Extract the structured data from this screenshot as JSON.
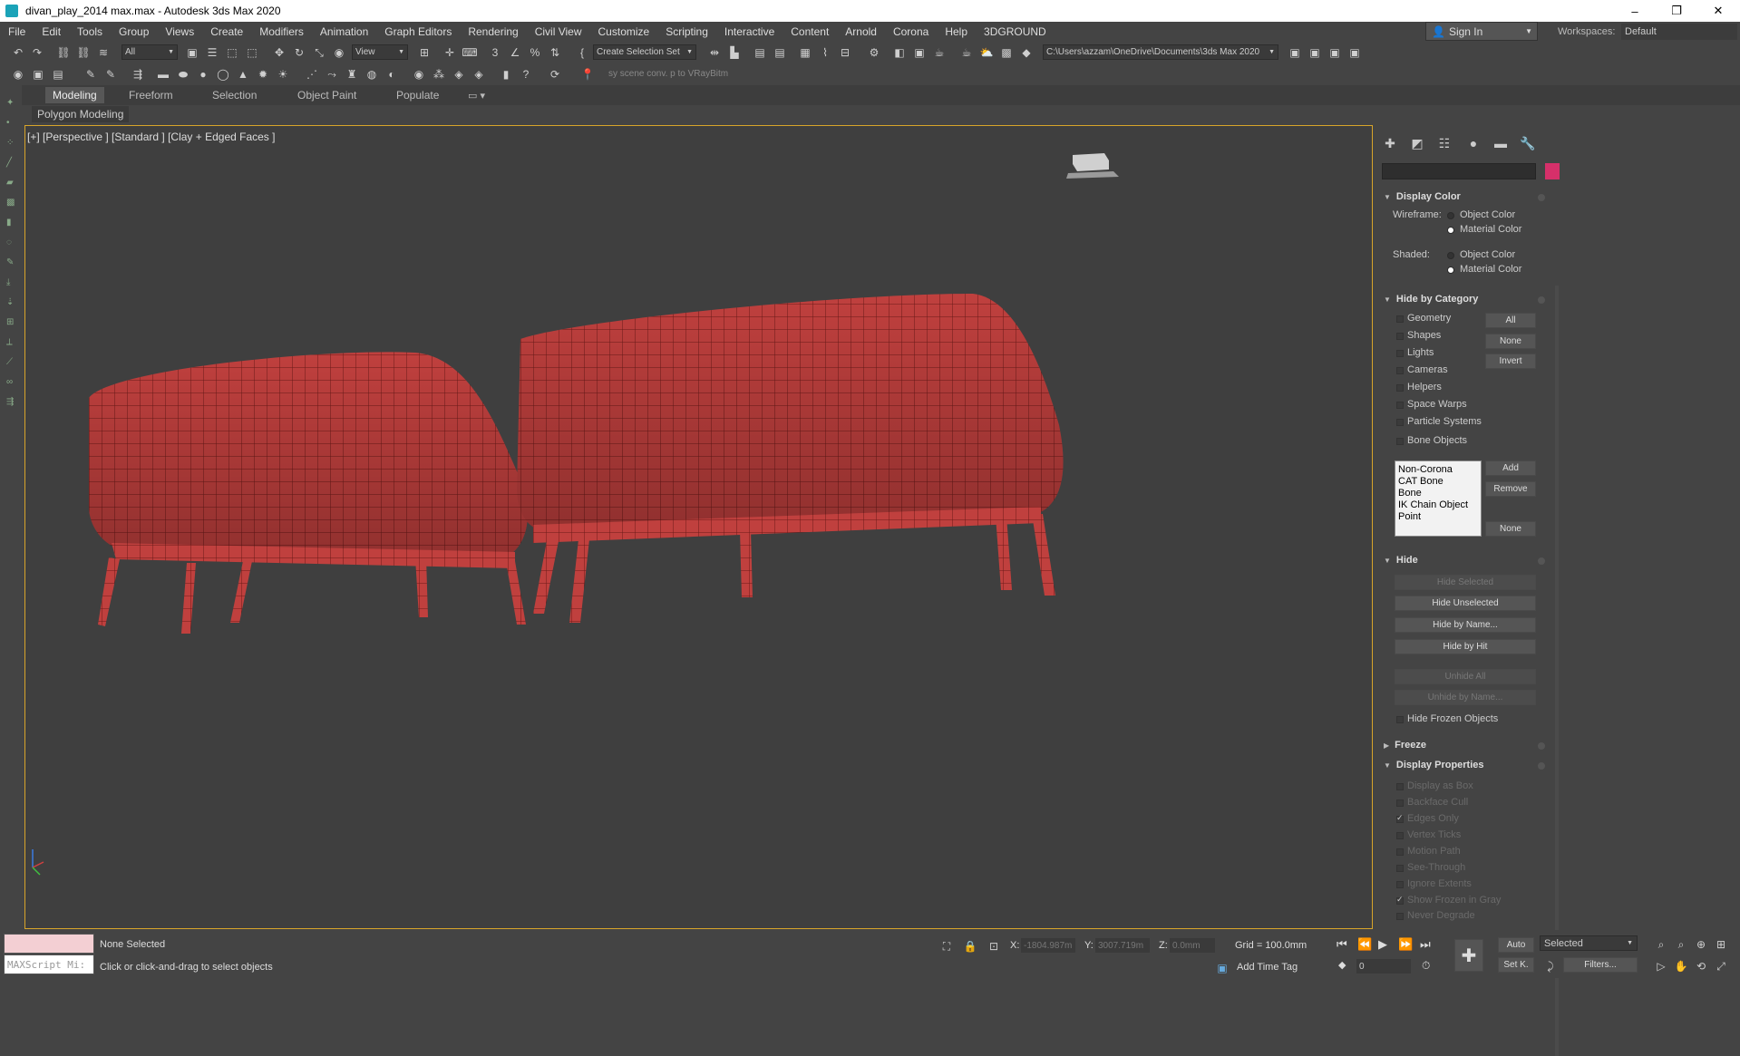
{
  "window": {
    "title": "divan_play_2014 max.max - Autodesk 3ds Max 2020",
    "minimize": "–",
    "restore": "❐",
    "close": "✕"
  },
  "menu": [
    "File",
    "Edit",
    "Tools",
    "Group",
    "Views",
    "Create",
    "Modifiers",
    "Animation",
    "Graph Editors",
    "Rendering",
    "Civil View",
    "Customize",
    "Scripting",
    "Interactive",
    "Content",
    "Arnold",
    "Corona",
    "Help",
    "3DGROUND"
  ],
  "account": {
    "sign_in": "Sign In",
    "workspaces_label": "Workspaces:",
    "workspace_value": "Default"
  },
  "toolbar": {
    "filter_value": "All",
    "refcoord_value": "View",
    "selection_set": "Create Selection Set",
    "project_path": "C:\\Users\\azzam\\OneDrive\\Documents\\3ds Max 2020",
    "vray_hint": "sy scene conv. p to VRayBitm"
  },
  "ribbon": {
    "tabs": [
      "Modeling",
      "Freeform",
      "Selection",
      "Object Paint",
      "Populate"
    ],
    "active_tab": "Modeling",
    "panel": "Polygon Modeling"
  },
  "viewport": {
    "label": "[+] [Perspective ] [Standard ] [Clay + Edged Faces ]",
    "mesh_color": "#c0403e",
    "wire_color": "#6b1a18"
  },
  "command_panel": {
    "swatch_color": "#d6306a",
    "display_color": {
      "title": "Display Color",
      "wireframe_label": "Wireframe:",
      "shaded_label": "Shaded:",
      "object_color": "Object Color",
      "material_color": "Material Color"
    },
    "hide_by_category": {
      "title": "Hide by Category",
      "items": [
        "Geometry",
        "Shapes",
        "Lights",
        "Cameras",
        "Helpers",
        "Space Warps",
        "Particle Systems",
        "Bone Objects"
      ],
      "btn_all": "All",
      "btn_none": "None",
      "btn_invert": "Invert",
      "list": [
        "Non-Corona",
        "CAT Bone",
        "Bone",
        "IK Chain Object",
        "Point"
      ],
      "btn_add": "Add",
      "btn_remove": "Remove",
      "btn_none2": "None"
    },
    "hide": {
      "title": "Hide",
      "hide_selected": "Hide Selected",
      "hide_unselected": "Hide Unselected",
      "hide_by_name": "Hide by Name...",
      "hide_by_hit": "Hide by Hit",
      "unhide_all": "Unhide All",
      "unhide_by_name": "Unhide by Name...",
      "hide_frozen": "Hide Frozen Objects"
    },
    "freeze": {
      "title": "Freeze"
    },
    "display_properties": {
      "title": "Display Properties",
      "items": [
        "Display as Box",
        "Backface Cull",
        "Edges Only",
        "Vertex Ticks",
        "Motion Path",
        "See-Through",
        "Ignore Extents",
        "Show Frozen in Gray",
        "Never Degrade"
      ]
    }
  },
  "status": {
    "maxscript": "MAXScript Mi:",
    "none_selected": "None Selected",
    "prompt": "Click or click-and-drag to select objects",
    "x_label": "X:",
    "x_value": "-1804.987m",
    "y_label": "Y:",
    "y_value": "3007.719m",
    "z_label": "Z:",
    "z_value": "0.0mm",
    "grid": "Grid = 100.0mm",
    "add_time_tag": "Add Time Tag",
    "auto": "Auto",
    "set_key": "Set K.",
    "selected": "Selected",
    "filters": "Filters...",
    "frame": "0"
  }
}
